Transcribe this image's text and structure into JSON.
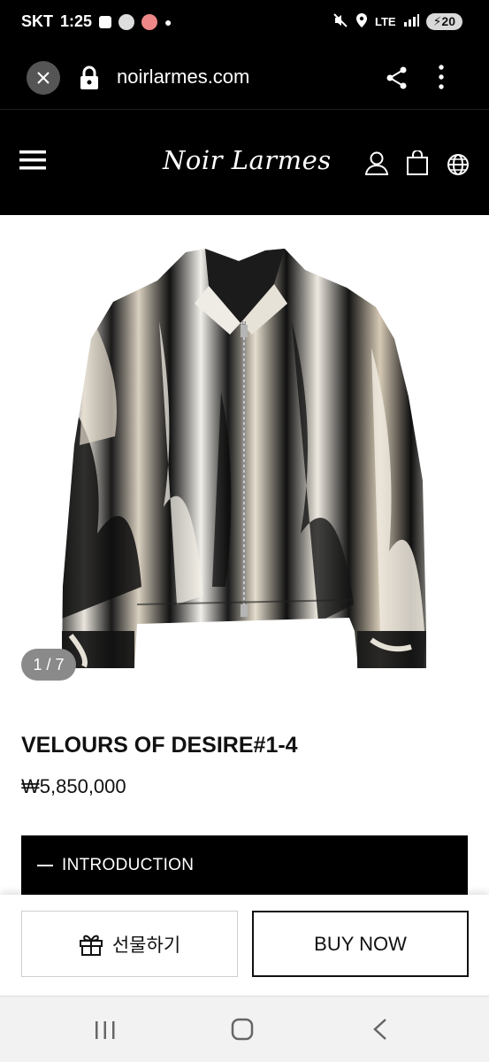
{
  "status_bar": {
    "carrier": "SKT",
    "time": "1:25",
    "network": "LTE",
    "battery": "20"
  },
  "browser": {
    "url": "noirlarmes.com"
  },
  "site": {
    "logo": "Noir Larmes"
  },
  "gallery": {
    "counter": "1 / 7",
    "image_subject": "black and white tie-dye velour zip jacket"
  },
  "product": {
    "title": "VELOURS OF DESIRE#1-4",
    "price": "₩5,850,000"
  },
  "section": {
    "introduction": "INTRODUCTION"
  },
  "actions": {
    "gift_label": "선물하기",
    "buy_label": "BUY NOW"
  },
  "icons": {
    "close": "close-icon",
    "lock": "lock-icon",
    "share": "share-icon",
    "more": "more-vert-icon",
    "menu": "menu-icon",
    "user": "user-icon",
    "bag": "shopping-bag-icon",
    "globe": "globe-icon",
    "gift": "gift-icon",
    "recents": "recents-icon",
    "home": "home-icon",
    "back": "back-icon"
  },
  "colors": {
    "header_bg": "#000000",
    "intro_bg": "#000000",
    "counter_bg": "#8a8a8a",
    "nav_bg": "#f2f2f2"
  }
}
